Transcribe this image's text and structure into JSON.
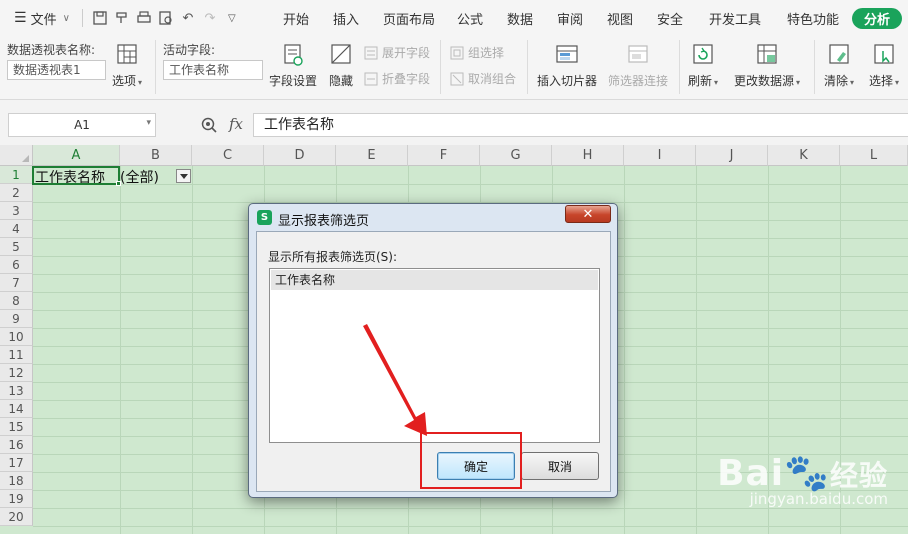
{
  "menubar": {
    "file_label": "文件",
    "tabs": [
      "开始",
      "插入",
      "页面布局",
      "公式",
      "数据",
      "审阅",
      "视图",
      "安全",
      "开发工具",
      "特色功能"
    ],
    "active_tab": "分析"
  },
  "ribbon": {
    "pivot_name_label": "数据透视表名称:",
    "pivot_name_value": "数据透视表1",
    "options_label": "选项",
    "active_field_label": "活动字段:",
    "active_field_value": "工作表名称",
    "field_settings_label": "字段设置",
    "hide_label": "隐藏",
    "expand_field_label": "展开字段",
    "collapse_field_label": "折叠字段",
    "group_select_label": "组选择",
    "ungroup_label": "取消组合",
    "insert_slicer_label": "插入切片器",
    "filter_connection_label": "筛选器连接",
    "refresh_label": "刷新",
    "change_source_label": "更改数据源",
    "clear_label": "清除",
    "select_label": "选择"
  },
  "formula_bar": {
    "cell_ref": "A1",
    "fx_label": "fx",
    "value": "工作表名称"
  },
  "sheet": {
    "columns": [
      "A",
      "B",
      "C",
      "D",
      "E",
      "F",
      "G",
      "H",
      "I",
      "J",
      "K",
      "L"
    ],
    "rows": [
      "1",
      "2",
      "3",
      "4",
      "5",
      "6",
      "7",
      "8",
      "9",
      "10",
      "11",
      "12",
      "13",
      "14",
      "15",
      "16",
      "17",
      "18",
      "19",
      "20"
    ],
    "a1": "工作表名称",
    "b1": "(全部)"
  },
  "dialog": {
    "logo_text": "S",
    "title": "显示报表筛选页",
    "close_label": "✕",
    "list_label": "显示所有报表筛选页(S):",
    "items": [
      "工作表名称"
    ],
    "ok_label": "确定",
    "cancel_label": "取消"
  },
  "watermark": {
    "main": "Bai",
    "main_suffix": "经验",
    "sub": "jingyan.baidu.com"
  },
  "colors": {
    "accent": "#1aa35b",
    "grid_bg": "#cfe8cf",
    "annotation": "#e21f1f"
  }
}
